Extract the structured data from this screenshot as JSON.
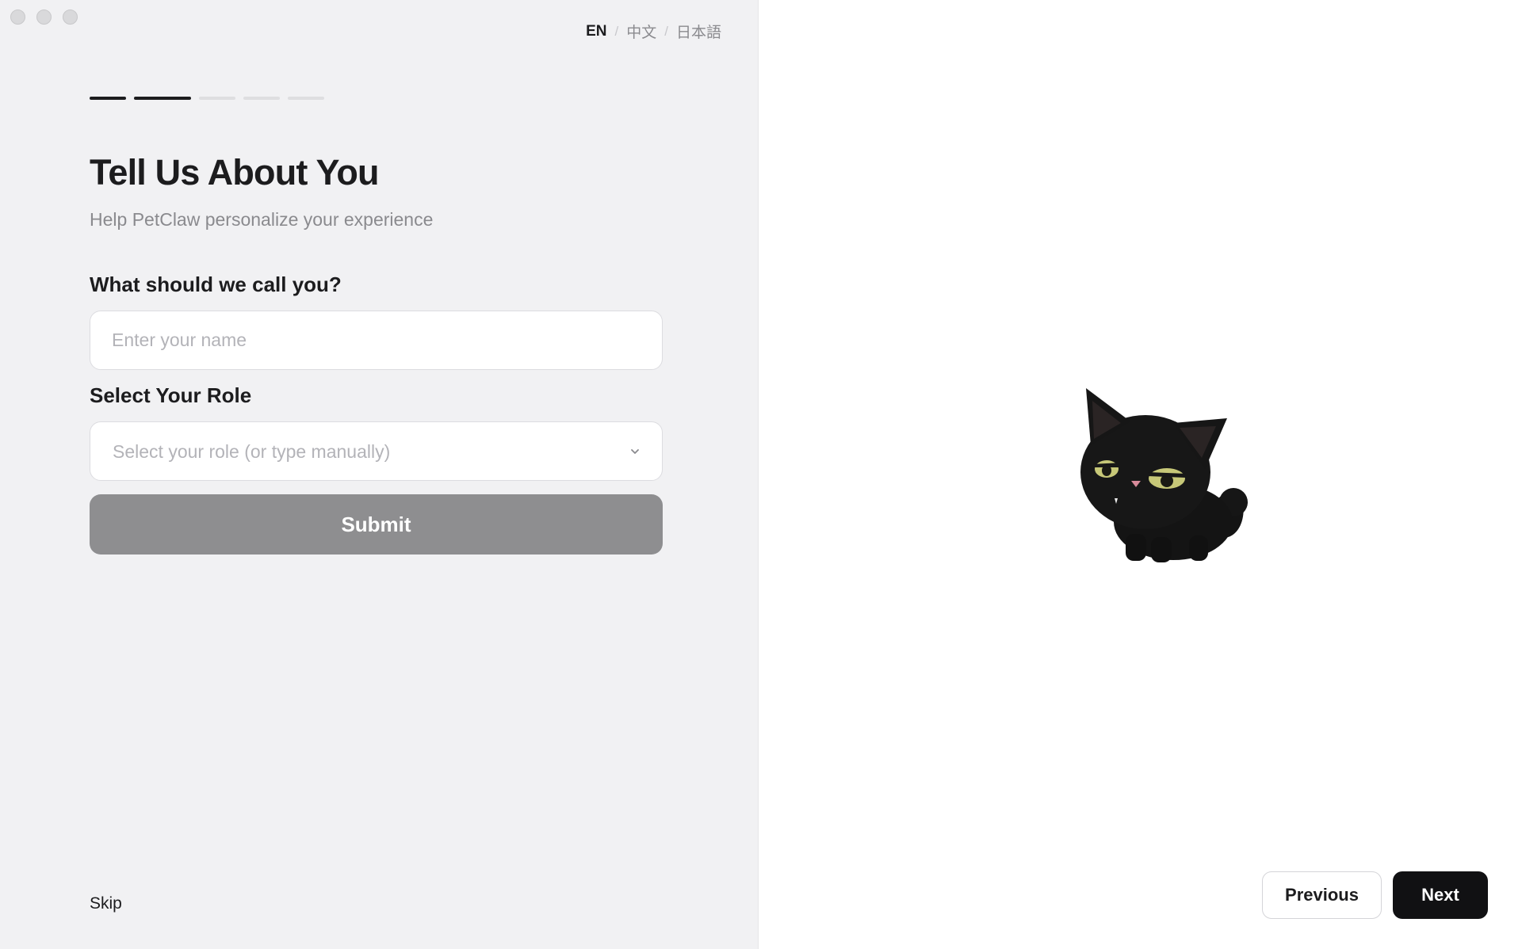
{
  "window": {
    "controls": [
      "close",
      "minimize",
      "zoom"
    ]
  },
  "language_switcher": {
    "active": "EN",
    "options": [
      "EN",
      "中文",
      "日本語"
    ],
    "separator": "/"
  },
  "progress": {
    "total_steps": 5,
    "completed_steps": 2,
    "active_color": "#1c1c1e",
    "inactive_color": "#dedee0"
  },
  "header": {
    "title": "Tell Us About You",
    "subtitle": "Help PetClaw personalize your experience"
  },
  "form": {
    "name_label": "What should we call you?",
    "name_placeholder": "Enter your name",
    "name_value": "",
    "role_label": "Select Your Role",
    "role_placeholder": "Select your role (or type manually)",
    "submit_label": "Submit"
  },
  "footer": {
    "skip_label": "Skip",
    "previous_label": "Previous",
    "next_label": "Next"
  },
  "illustration": {
    "icon": "black-cat-mascot"
  },
  "colors": {
    "left_bg": "#f1f1f3",
    "right_bg": "#ffffff",
    "submit_disabled": "#8e8e90",
    "next_button": "#111113"
  }
}
